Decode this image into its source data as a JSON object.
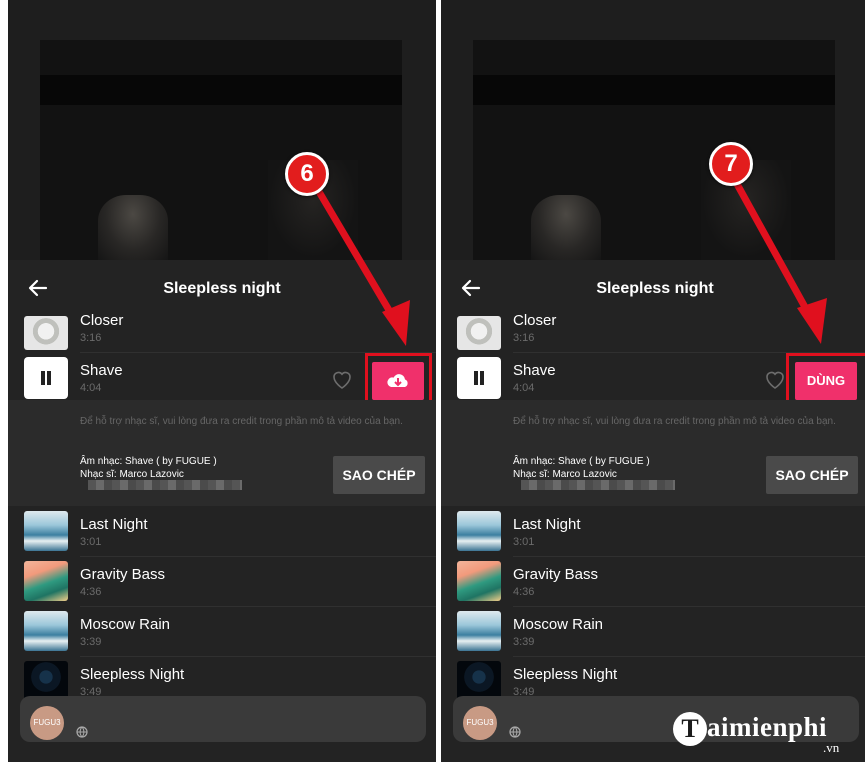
{
  "colors": {
    "accent": "#f0306b",
    "highlight": "#e0101e",
    "sheet": "#232323"
  },
  "screens": [
    {
      "header": {
        "title": "Sleepless night",
        "back_icon": "arrow-left-icon"
      },
      "tracks": [
        {
          "title": "Closer",
          "duration": "3:16"
        },
        {
          "title": "Shave",
          "duration": "4:04"
        },
        {
          "title": "Last Night",
          "duration": "3:01"
        },
        {
          "title": "Gravity Bass",
          "duration": "4:36"
        },
        {
          "title": "Moscow Rain",
          "duration": "3:39"
        },
        {
          "title": "Sleepless Night",
          "duration": "3:49"
        }
      ],
      "details": {
        "note": "Để hỗ trợ nhạc sĩ, vui lòng đưa ra credit trong phần mô tả video của bạn.",
        "music_line": "Âm nhạc: Shave ( by FUGUE )",
        "artist_line": "Nhạc sĩ: Marco Lazovic",
        "copy_label": "SAO CHÉP"
      },
      "action": {
        "icon": "cloud-download-icon"
      },
      "callout": "6",
      "avatar_text": "FUGU3"
    },
    {
      "header": {
        "title": "Sleepless night",
        "back_icon": "arrow-left-icon"
      },
      "tracks": [
        {
          "title": "Closer",
          "duration": "3:16"
        },
        {
          "title": "Shave",
          "duration": "4:04"
        },
        {
          "title": "Last Night",
          "duration": "3:01"
        },
        {
          "title": "Gravity Bass",
          "duration": "4:36"
        },
        {
          "title": "Moscow Rain",
          "duration": "3:39"
        },
        {
          "title": "Sleepless Night",
          "duration": "3:49"
        }
      ],
      "details": {
        "note": "Để hỗ trợ nhạc sĩ, vui lòng đưa ra credit trong phần mô tả video của bạn.",
        "music_line": "Âm nhạc: Shave ( by FUGUE )",
        "artist_line": "Nhạc sĩ: Marco Lazovic",
        "copy_label": "SAO CHÉP"
      },
      "action": {
        "label": "DÙNG"
      },
      "callout": "7",
      "avatar_text": "FUGU3"
    }
  ],
  "watermark": {
    "brand": "aimienphi",
    "brand_initial": "T",
    "suffix": ".vn"
  }
}
